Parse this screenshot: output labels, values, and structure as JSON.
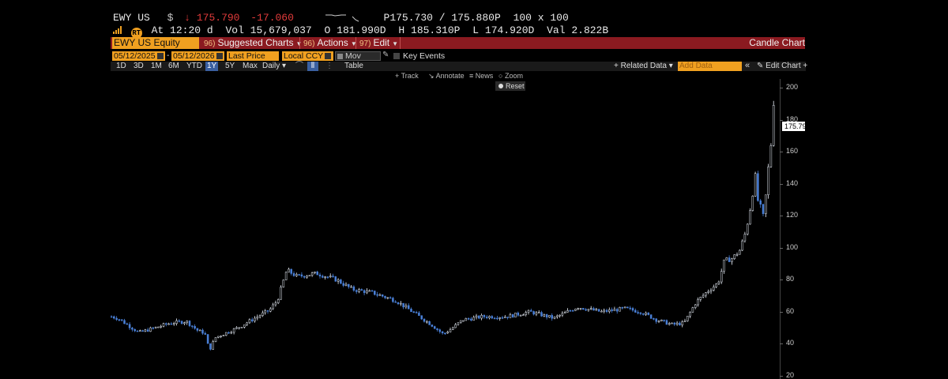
{
  "quote": {
    "ticker": "EWY US",
    "currency": "$",
    "arrow": "↓",
    "last": "175.790",
    "change": "-17.060",
    "bid_ask": "P175.730 / 175.880P",
    "size": "100 x 100",
    "rt_icon": "RT",
    "at_label": "At",
    "time": "12:20",
    "d_label": "d",
    "vol_label": "Vol",
    "vol": "15,679,037",
    "o_label": "O",
    "open": "181.990D",
    "h_label": "H",
    "high": "185.310P",
    "l_label": "L",
    "low": "174.920D",
    "val_label": "Val",
    "value": "2.822B"
  },
  "toolbar": {
    "security": "EWY US Equity",
    "suggested": "Suggested Charts",
    "actions": "Actions",
    "edit": "Edit",
    "chart_type": "Candle Chart",
    "glyph_suggested": "96)",
    "glyph_actions": "96)",
    "glyph_edit": "97)"
  },
  "options": {
    "start_date": "05/12/2025",
    "end_date": "05/12/2026",
    "field": "Last Price",
    "currency": "Local CCY",
    "mov_avgs": "Mov Avgs",
    "key_events": "Key Events"
  },
  "ranges": [
    "1D",
    "3D",
    "1M",
    "6M",
    "YTD",
    "1Y",
    "5Y",
    "Max"
  ],
  "active_range": "1Y",
  "period": "Daily",
  "table_label": "Table",
  "related_data": "Related Data",
  "add_data_placeholder": "Add Data",
  "edit_chart": "Edit Chart",
  "chart_tools": {
    "track": "Track",
    "annotate": "Annotate",
    "news": "News",
    "zoom": "Zoom",
    "reset": "Reset"
  },
  "axis": {
    "ticks": [
      "200",
      "180",
      "160",
      "140",
      "120",
      "100",
      "80",
      "60",
      "40",
      "20"
    ],
    "last_label": "175.79"
  },
  "colors": {
    "accent": "#f0a020",
    "bar": "#8b1a20",
    "down": "#e23b3b",
    "candle": "#e8eef8",
    "candle_blue": "#4a80d8"
  },
  "chart_data": {
    "type": "candlestick",
    "title": "",
    "xlabel": "",
    "ylabel": "",
    "x_range": [
      "05/12/2025",
      "05/12/2026"
    ],
    "ylim": [
      20,
      205
    ],
    "anchors": [
      [
        0,
        57
      ],
      [
        8,
        56
      ],
      [
        20,
        52
      ],
      [
        35,
        47
      ],
      [
        55,
        50
      ],
      [
        75,
        53
      ],
      [
        95,
        54
      ],
      [
        110,
        48
      ],
      [
        118,
        47
      ],
      [
        124,
        36
      ],
      [
        132,
        44
      ],
      [
        160,
        50
      ],
      [
        185,
        57
      ],
      [
        200,
        61
      ],
      [
        210,
        67
      ],
      [
        222,
        86
      ],
      [
        235,
        82
      ],
      [
        260,
        84
      ],
      [
        285,
        80
      ],
      [
        305,
        74
      ],
      [
        330,
        72
      ],
      [
        360,
        67
      ],
      [
        390,
        57
      ],
      [
        405,
        52
      ],
      [
        420,
        46
      ],
      [
        432,
        50
      ],
      [
        445,
        55
      ],
      [
        470,
        57
      ],
      [
        500,
        57
      ],
      [
        530,
        60
      ],
      [
        560,
        56
      ],
      [
        590,
        63
      ],
      [
        620,
        60
      ],
      [
        650,
        62
      ],
      [
        670,
        60
      ],
      [
        690,
        55
      ],
      [
        710,
        52
      ],
      [
        725,
        53
      ],
      [
        740,
        66
      ],
      [
        755,
        73
      ],
      [
        768,
        78
      ],
      [
        776,
        92
      ],
      [
        785,
        93
      ],
      [
        795,
        98
      ],
      [
        803,
        110
      ],
      [
        810,
        128
      ],
      [
        815,
        145
      ],
      [
        818,
        130
      ],
      [
        822,
        125
      ],
      [
        826,
        118
      ],
      [
        830,
        143
      ],
      [
        834,
        160
      ],
      [
        836,
        170
      ],
      [
        838,
        192
      ],
      [
        841,
        177
      ]
    ],
    "last": 175.79
  }
}
